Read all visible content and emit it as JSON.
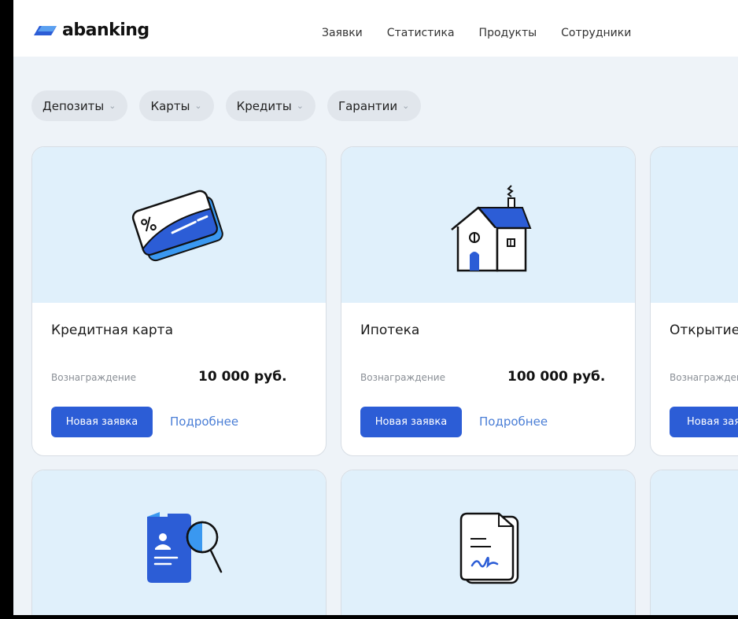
{
  "brand": {
    "name": "abanking"
  },
  "nav": {
    "items": [
      "Заявки",
      "Статистика",
      "Продукты",
      "Сотрудники"
    ]
  },
  "filters": [
    {
      "label": "Депозиты"
    },
    {
      "label": "Карты"
    },
    {
      "label": "Кредиты"
    },
    {
      "label": "Гарантии"
    }
  ],
  "products": [
    {
      "title": "Кредитная карта",
      "reward_label": "Вознаграждение",
      "reward_value": "10 000 руб.",
      "primary_action": "Новая заявка",
      "secondary_action": "Подробнее",
      "icon": "credit-card-icon"
    },
    {
      "title": "Ипотека",
      "reward_label": "Вознаграждение",
      "reward_value": "100 000 руб.",
      "primary_action": "Новая заявка",
      "secondary_action": "Подробнее",
      "icon": "house-icon"
    },
    {
      "title": "Открытие",
      "reward_label": "Вознагражден",
      "primary_action": "Новая зая",
      "icon": ""
    },
    {
      "icon": "document-search-icon"
    },
    {
      "icon": "signed-document-icon"
    },
    {
      "icon": ""
    }
  ],
  "colors": {
    "accent": "#2c5dd6",
    "link": "#4a7ed6",
    "card_image_bg": "#e0f0fb",
    "page_bg": "#eef3f8"
  }
}
